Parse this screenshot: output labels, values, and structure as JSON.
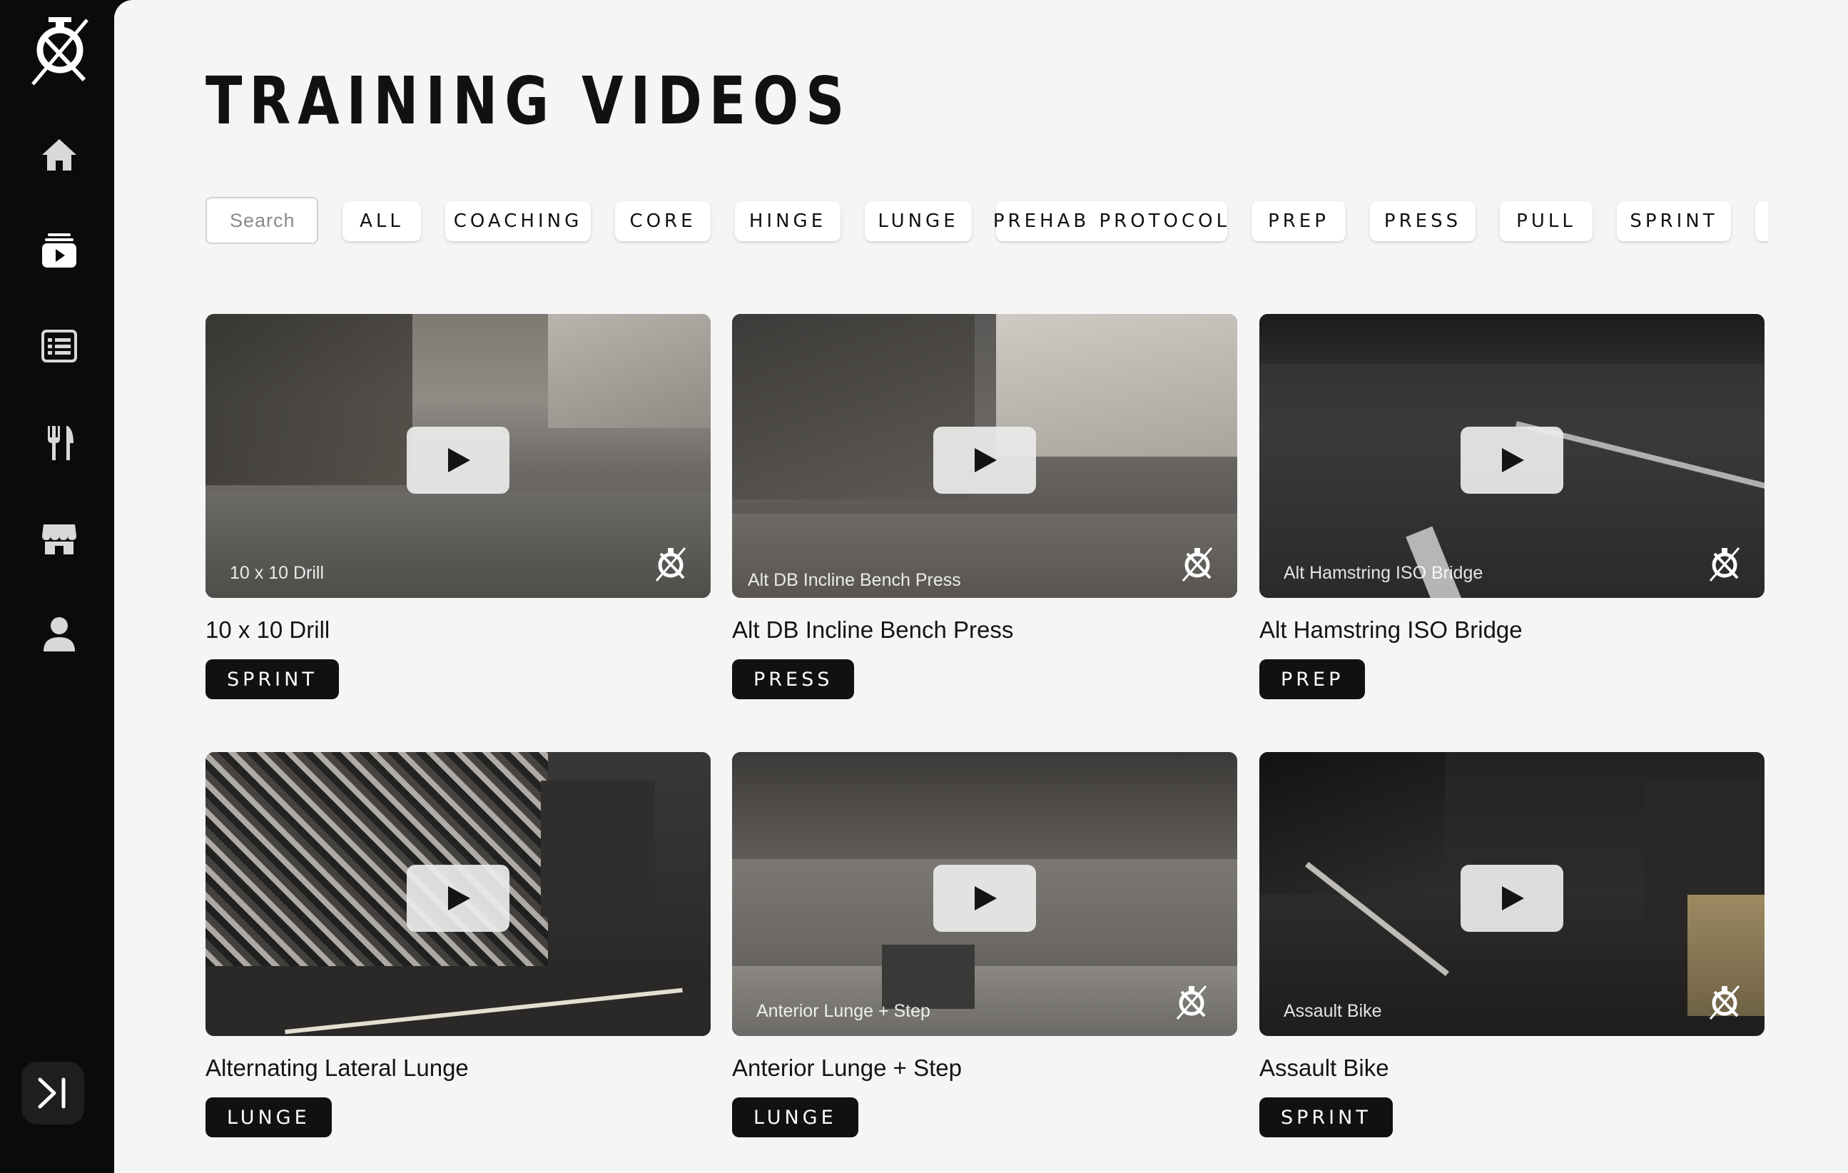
{
  "page": {
    "title": "TRAINING VIDEOS"
  },
  "sidebar": {
    "items": [
      {
        "name": "home",
        "icon": "home-icon"
      },
      {
        "name": "videos",
        "icon": "video-library-icon"
      },
      {
        "name": "programs",
        "icon": "list-icon"
      },
      {
        "name": "nutrition",
        "icon": "utensils-icon"
      },
      {
        "name": "store",
        "icon": "store-icon"
      },
      {
        "name": "profile",
        "icon": "user-icon"
      }
    ],
    "collapse_icon": "expand-sidebar-icon"
  },
  "search": {
    "placeholder": "Search"
  },
  "filters": [
    "ALL",
    "COACHING",
    "CORE",
    "HINGE",
    "LUNGE",
    "PREHAB PROTOCOL",
    "PREP",
    "PRESS",
    "PULL",
    "SPRINT"
  ],
  "videos": [
    {
      "title": "10 x 10 Drill",
      "caption": "10 x 10 Drill",
      "tag": "SPRINT"
    },
    {
      "title": "Alt DB Incline Bench Press",
      "caption": "Alt DB Incline Bench Press",
      "tag": "PRESS"
    },
    {
      "title": "Alt Hamstring ISO Bridge",
      "caption": "Alt Hamstring ISO Bridge",
      "tag": "PREP"
    },
    {
      "title": "Alternating Lateral Lunge",
      "caption": "",
      "tag": "LUNGE"
    },
    {
      "title": "Anterior Lunge + Step",
      "caption": "Anterior Lunge + Step",
      "tag": "LUNGE"
    },
    {
      "title": "Assault Bike",
      "caption": "Assault Bike",
      "tag": "SPRINT"
    }
  ],
  "colors": {
    "sidebar_bg": "#0b0b0b",
    "page_bg": "#f5f5f5",
    "tag_bg": "#111111",
    "accent": "#ffffff"
  }
}
